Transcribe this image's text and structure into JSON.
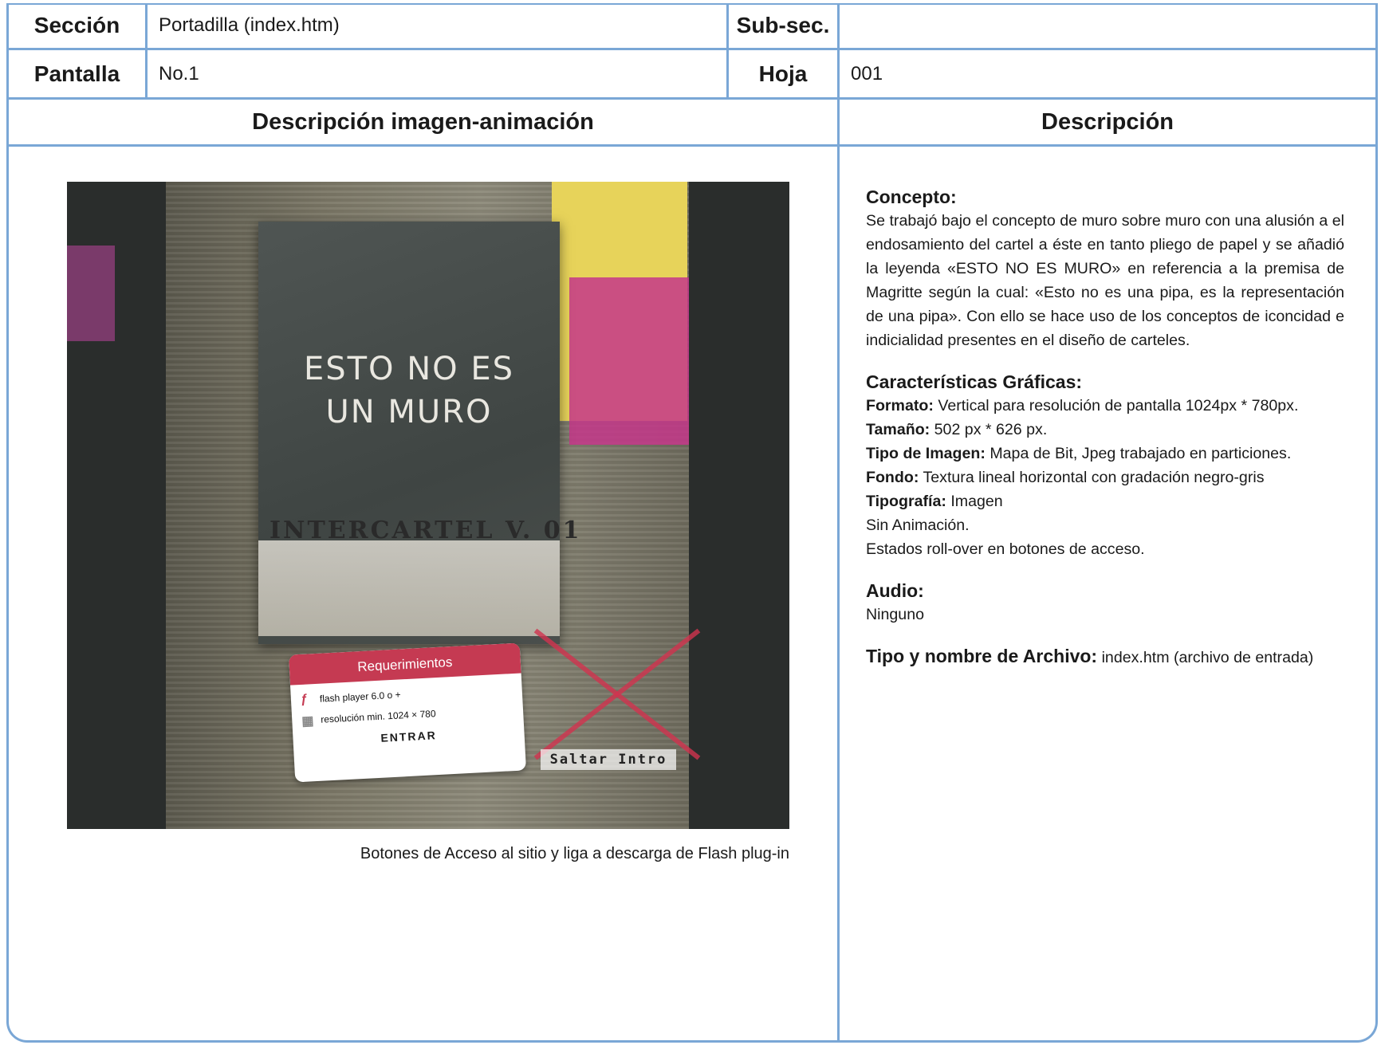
{
  "header": {
    "seccion_label": "Sección",
    "seccion_value": "Portadilla (index.htm)",
    "subsec_label": "Sub-sec.",
    "subsec_value": "",
    "pantalla_label": "Pantalla",
    "pantalla_value": "No.1",
    "hoja_label": "Hoja",
    "hoja_value": "001"
  },
  "columns": {
    "left_title": "Descripción imagen-animación",
    "right_title": "Descripción"
  },
  "image": {
    "poster_line1": "ESTO NO ES",
    "poster_line2": "UN MURO",
    "poster_stamp": "INTERCARTEL V. 01",
    "requirements_title": "Requerimientos",
    "req_flash": "flash player 6.0 o +",
    "req_resolution": "resolución min. 1024 × 780",
    "enter_button": "ENTRAR",
    "skip_intro": "Saltar Intro",
    "caption": "Botones de Acceso al sitio y liga a descarga de Flash plug-in"
  },
  "description": {
    "concepto_title": "Concepto:",
    "concepto_text": "Se trabajó bajo el concepto de muro sobre muro con una alusión a el endosamiento del cartel a éste en tanto pliego de papel y se añadió la leyenda «ESTO NO ES MURO» en referencia a la premisa de Magritte según la cual: «Esto no es una pipa, es la representación de una pipa». Con ello se hace uso de los conceptos de iconcidad e indicialidad presentes en el diseño de carteles.",
    "graficas_title": "Características Gráficas:",
    "formato_label": "Formato:",
    "formato_value": "Vertical para resolución de pantalla 1024px * 780px.",
    "tamano_label": "Tamaño:",
    "tamano_value": "502 px * 626 px.",
    "tipo_imagen_label": "Tipo de Imagen:",
    "tipo_imagen_value": "Mapa de Bit, Jpeg trabajado en particiones.",
    "fondo_label": "Fondo:",
    "fondo_value": "Textura lineal horizontal con gradación negro-gris",
    "tipografia_label": "Tipografía:",
    "tipografia_value": "Imagen",
    "animacion": "Sin Animación.",
    "rollover": "Estados roll-over en botones de acceso.",
    "audio_title": "Audio:",
    "audio_value": "Ninguno",
    "archivo_label": "Tipo y nombre de Archivo:",
    "archivo_value": "index.htm (archivo de entrada)"
  },
  "colors": {
    "border": "#7aa7d6",
    "requirements_red": "#c53a52"
  }
}
